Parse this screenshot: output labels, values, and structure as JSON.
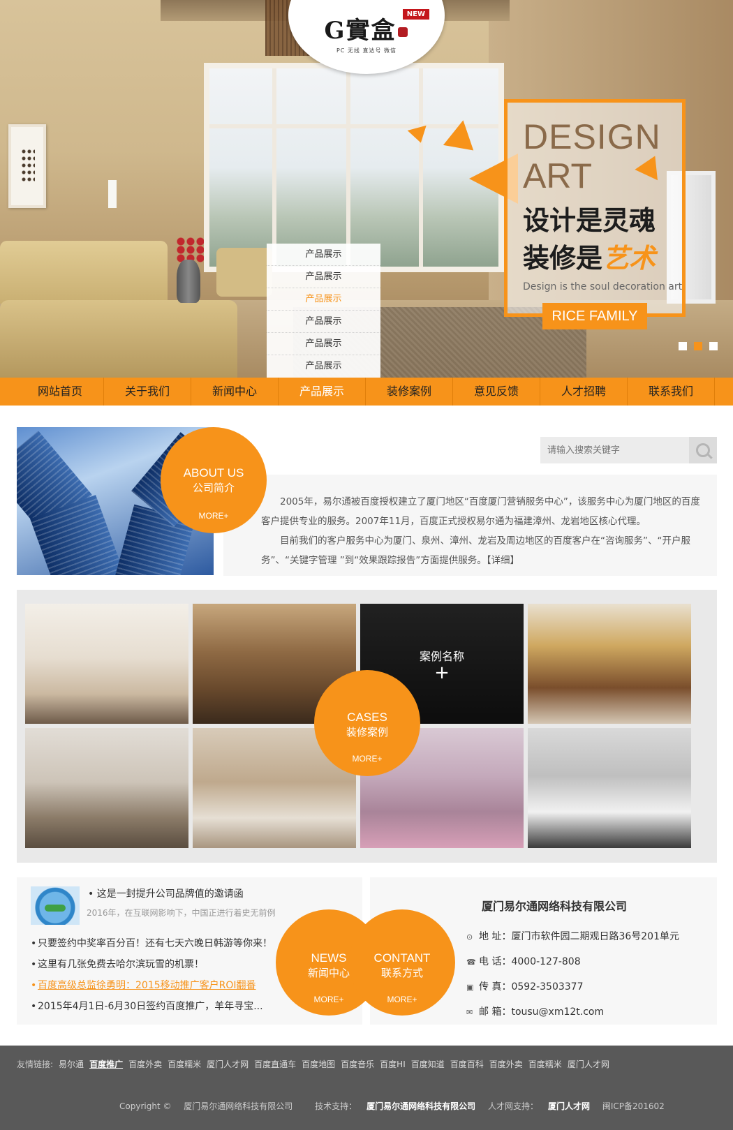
{
  "brand": {
    "logo_text": "G實盒",
    "badge": "NEW",
    "tagline": "PC 无线 直达号 微信"
  },
  "hero": {
    "dropdown": [
      {
        "label": "产品展示",
        "active": false
      },
      {
        "label": "产品展示",
        "active": false
      },
      {
        "label": "产品展示",
        "active": true
      },
      {
        "label": "产品展示",
        "active": false
      },
      {
        "label": "产品展示",
        "active": false
      },
      {
        "label": "产品展示",
        "active": false
      }
    ],
    "design_line1": "DESIGN",
    "design_line2": "ART",
    "cn_line1": "设计是灵魂",
    "cn_line2_prefix": "装修是",
    "cn_line2_art": "艺术",
    "sub_text": "Design is the soul decoration art",
    "tag": "RICE FAMILY",
    "accent": "#f7931a",
    "slide_count": 3,
    "active_slide": 2
  },
  "nav": {
    "items": [
      "网站首页",
      "关于我们",
      "新闻中心",
      "产品展示",
      "装修案例",
      "意见反馈",
      "人才招聘",
      "联系我们"
    ],
    "active_index": 3
  },
  "about": {
    "title_en": "ABOUT US",
    "title_cn": "公司简介",
    "more": "MORE+",
    "paragraph1": "2005年，易尔通被百度授权建立了厦门地区“百度厦门营销服务中心”，该服务中心为厦门地区的百度客户提供专业的服务。2007年11月，百度正式授权易尔通为福建漳州、龙岩地区核心代理。",
    "paragraph2": "目前我们的客户服务中心为厦门、泉州、漳州、龙岩及周边地区的百度客户在“咨询服务”、“开户服务”、“关键字管理 ”到“效果跟踪报告”方面提供服务。【详细】"
  },
  "search": {
    "placeholder": "请输入搜索关键字",
    "icon": "search-icon"
  },
  "cases": {
    "title_en": "CASES",
    "title_cn": "装修案例",
    "more": "MORE+",
    "hover_name": "案例名称",
    "hover_plus": "+",
    "hovered_index": 2,
    "count": 8
  },
  "news": {
    "title_en": "NEWS",
    "title_cn": "新闻中心",
    "more": "MORE+",
    "featured_title": "这是一封提升公司品牌值的邀请函",
    "featured_summary": "2016年，在互联网影响下，中国正进行着史无前例",
    "items": [
      {
        "text": "只要签约中奖率百分百！还有七天六晚日韩游等你来！",
        "highlight": false
      },
      {
        "text": "这里有几张免费去哈尔滨玩雪的机票！",
        "highlight": false
      },
      {
        "text": "百度高级总监徐勇明：2015移动推广客户ROI翻番",
        "highlight": true
      },
      {
        "text": "2015年4月1日-6月30日签约百度推广，羊年寻宝...",
        "highlight": false
      }
    ]
  },
  "contact": {
    "title_en": "CONTANT",
    "title_cn": "联系方式",
    "more": "MORE+",
    "company": "厦门易尔通网络科技有限公司",
    "address": "地 址：厦门市软件园二期观日路36号201单元",
    "phone": "电 话：4000-127-808",
    "fax": "传 真：0592-3503377",
    "email": "邮 箱：tousu@xm12t.com"
  },
  "footer": {
    "links_label": "友情链接:",
    "links": [
      "易尔通",
      "百度推广",
      "百度外卖",
      "百度糯米",
      "厦门人才网",
      "百度直通车",
      "百度地图",
      "百度音乐",
      "百度HI",
      "百度知道",
      "百度百科",
      "百度外卖",
      "百度糯米",
      "厦门人才网"
    ],
    "active_link": 1,
    "copyright_prefix": "Copyright ©",
    "copyright_company": "厦门易尔通网络科技有限公司",
    "tech_label": "技术支持：",
    "tech_company": "厦门易尔通网络科技有限公司",
    "talent_label": "人才网支持：",
    "talent_site": "厦门人才网",
    "icp": "闽ICP备201602"
  }
}
